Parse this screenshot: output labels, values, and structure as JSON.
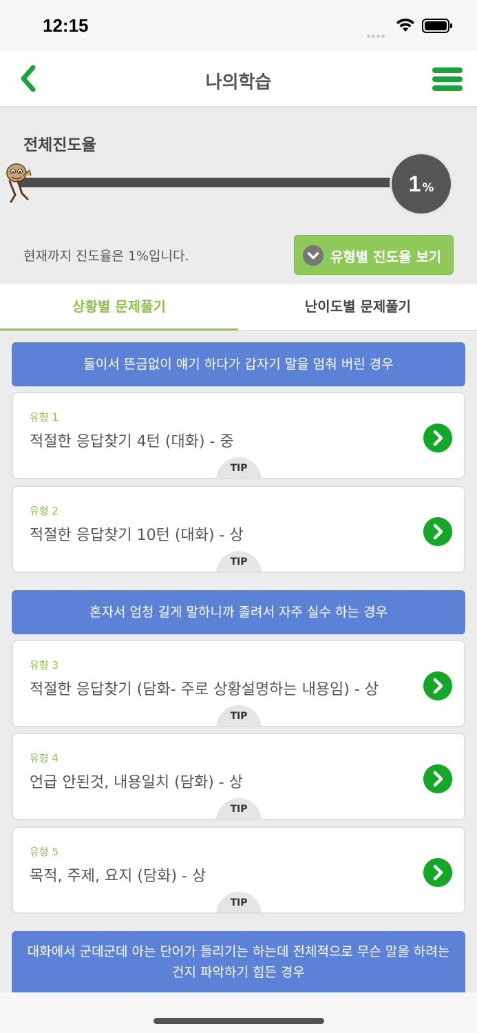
{
  "status_bar": {
    "time": "12:15"
  },
  "nav": {
    "title": "나의학습"
  },
  "progress": {
    "label": "전체진도율",
    "value": "1",
    "unit": "%",
    "fraction": 0.01,
    "message": "현재까지 진도율은 1%입니다.",
    "type_button_label": "유형별 진도율 보기"
  },
  "tabs": [
    {
      "label": "상황별 문제풀기",
      "active": true
    },
    {
      "label": "난이도별 문제풀기",
      "active": false
    }
  ],
  "sections": [
    {
      "header": "둘이서 뜬금없이 얘기 하다가 갑자기 말을 멈춰 버린 경우",
      "items": [
        {
          "type": "유형 1",
          "title": "적절한 응답찾기 4턴 (대화) - 중",
          "tip": "TIP"
        },
        {
          "type": "유형 2",
          "title": "적절한 응답찾기 10턴 (대화) - 상",
          "tip": "TIP"
        }
      ]
    },
    {
      "header": "혼자서 엄청 길게 말하니까 졸려서 자주 실수 하는 경우",
      "items": [
        {
          "type": "유형 3",
          "title": "적절한 응답찾기 (담화- 주로 상황설명하는 내용임) - 상",
          "tip": "TIP"
        },
        {
          "type": "유형 4",
          "title": "언급 안된것, 내용일치 (담화) - 상",
          "tip": "TIP"
        },
        {
          "type": "유형 5",
          "title": "목적, 주제, 요지 (담화) - 상",
          "tip": "TIP"
        }
      ]
    },
    {
      "header": "대화에서 군데군데 아는 단어가 들리기는 하는데 전체적으로 무슨 말을 하려는 건지 파악하기 힘든 경우",
      "items": []
    }
  ],
  "colors": {
    "accent_green": "#8cc34a",
    "nav_green": "#1aa33a",
    "arrow_green": "#13a827",
    "section_blue": "#5b82d7"
  },
  "icons": [
    "back-chevron-icon",
    "hamburger-menu-icon",
    "mascot-icon",
    "chevron-down-icon",
    "chevron-right-icon",
    "wifi-icon",
    "battery-icon",
    "signal-icon"
  ]
}
